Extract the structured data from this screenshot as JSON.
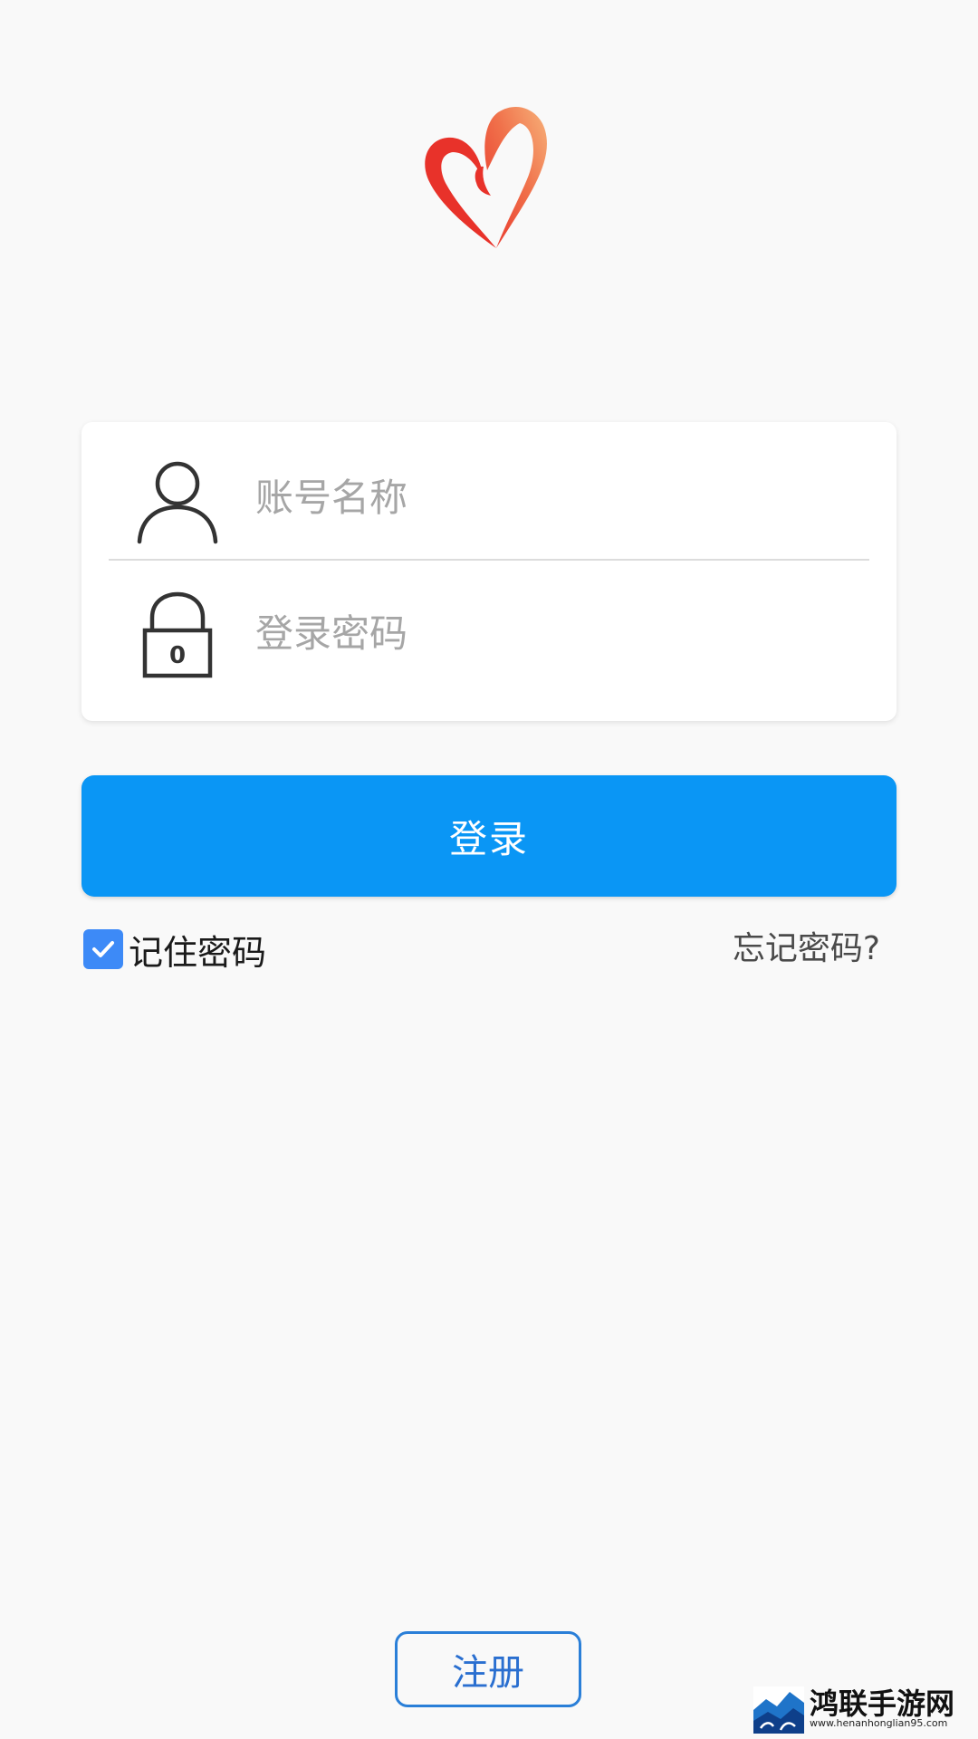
{
  "login_form": {
    "username_placeholder": "账号名称",
    "password_placeholder": "登录密码",
    "lock_digit": "0"
  },
  "actions": {
    "login_label": "登录",
    "remember_label": "记住密码",
    "remember_checked": true,
    "forgot_label": "忘记密码?",
    "register_label": "注册"
  },
  "watermark": {
    "title": "鸿联手游网",
    "url": "www.henanhonglian95.com"
  },
  "icons": {
    "logo": "heart-logo-icon",
    "username": "user-icon",
    "password": "lock-icon",
    "checkbox": "checkmark-icon"
  },
  "colors": {
    "primary": "#0a96f5",
    "checkbox": "#3d8af7",
    "register_border": "#2a7fd8",
    "background": "#f9f9f9",
    "logo_red": "#e8322a",
    "logo_orange": "#f6a66a"
  }
}
